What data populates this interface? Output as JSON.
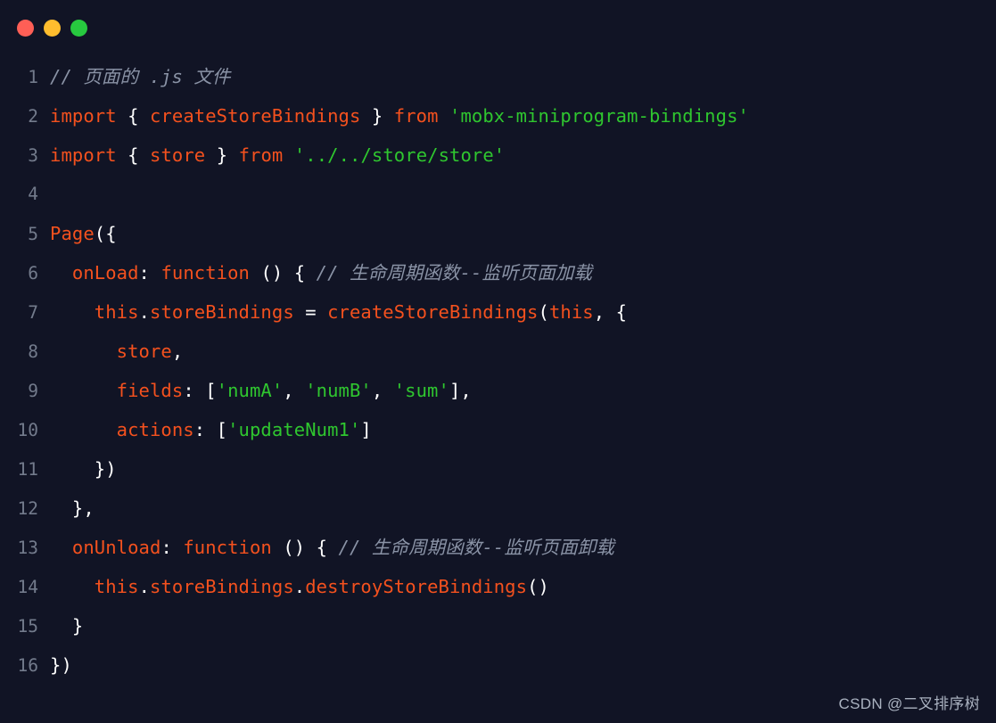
{
  "window": {
    "dots": [
      {
        "name": "close-button",
        "color": "#ff5f56"
      },
      {
        "name": "minimize-button",
        "color": "#ffbd2e"
      },
      {
        "name": "maximize-button",
        "color": "#27c93f"
      }
    ]
  },
  "editor": {
    "language": "javascript",
    "background": "#111425",
    "colors": {
      "comment": "#8a93a6",
      "keyword": "#f4511e",
      "identifier": "#f4511e",
      "string": "#2fc62f",
      "punctuation": "#ffffff",
      "line_number": "#737b8c"
    },
    "lines": [
      {
        "number": "1",
        "tokens": [
          {
            "t": "// 页面的 .js 文件",
            "c": "comment"
          }
        ]
      },
      {
        "number": "2",
        "tokens": [
          {
            "t": "import",
            "c": "keyword"
          },
          {
            "t": " ",
            "c": "plain"
          },
          {
            "t": "{",
            "c": "punct"
          },
          {
            "t": " ",
            "c": "plain"
          },
          {
            "t": "createStoreBindings",
            "c": "ident"
          },
          {
            "t": " ",
            "c": "plain"
          },
          {
            "t": "}",
            "c": "punct"
          },
          {
            "t": " ",
            "c": "plain"
          },
          {
            "t": "from",
            "c": "keyword"
          },
          {
            "t": " ",
            "c": "plain"
          },
          {
            "t": "'mobx-miniprogram-bindings'",
            "c": "string"
          }
        ]
      },
      {
        "number": "3",
        "tokens": [
          {
            "t": "import",
            "c": "keyword"
          },
          {
            "t": " ",
            "c": "plain"
          },
          {
            "t": "{",
            "c": "punct"
          },
          {
            "t": " ",
            "c": "plain"
          },
          {
            "t": "store",
            "c": "ident"
          },
          {
            "t": " ",
            "c": "plain"
          },
          {
            "t": "}",
            "c": "punct"
          },
          {
            "t": " ",
            "c": "plain"
          },
          {
            "t": "from",
            "c": "keyword"
          },
          {
            "t": " ",
            "c": "plain"
          },
          {
            "t": "'../../store/store'",
            "c": "string"
          }
        ]
      },
      {
        "number": "4",
        "tokens": []
      },
      {
        "number": "5",
        "tokens": [
          {
            "t": "Page",
            "c": "func"
          },
          {
            "t": "({",
            "c": "punct"
          }
        ]
      },
      {
        "number": "6",
        "tokens": [
          {
            "t": "  ",
            "c": "plain"
          },
          {
            "t": "onLoad",
            "c": "prop"
          },
          {
            "t": ": ",
            "c": "punct"
          },
          {
            "t": "function",
            "c": "keyword"
          },
          {
            "t": " ",
            "c": "plain"
          },
          {
            "t": "() { ",
            "c": "punct"
          },
          {
            "t": "// 生命周期函数--监听页面加载",
            "c": "comment"
          }
        ]
      },
      {
        "number": "7",
        "tokens": [
          {
            "t": "    ",
            "c": "plain"
          },
          {
            "t": "this",
            "c": "keyword"
          },
          {
            "t": ".",
            "c": "punct"
          },
          {
            "t": "storeBindings",
            "c": "prop"
          },
          {
            "t": " = ",
            "c": "punct"
          },
          {
            "t": "createStoreBindings",
            "c": "func"
          },
          {
            "t": "(",
            "c": "punct"
          },
          {
            "t": "this",
            "c": "keyword"
          },
          {
            "t": ", {",
            "c": "punct"
          }
        ]
      },
      {
        "number": "8",
        "tokens": [
          {
            "t": "      ",
            "c": "plain"
          },
          {
            "t": "store",
            "c": "ident"
          },
          {
            "t": ",",
            "c": "punct"
          }
        ]
      },
      {
        "number": "9",
        "tokens": [
          {
            "t": "      ",
            "c": "plain"
          },
          {
            "t": "fields",
            "c": "prop"
          },
          {
            "t": ": [",
            "c": "punct"
          },
          {
            "t": "'numA'",
            "c": "string"
          },
          {
            "t": ", ",
            "c": "punct"
          },
          {
            "t": "'numB'",
            "c": "string"
          },
          {
            "t": ", ",
            "c": "punct"
          },
          {
            "t": "'sum'",
            "c": "string"
          },
          {
            "t": "],",
            "c": "punct"
          }
        ]
      },
      {
        "number": "10",
        "tokens": [
          {
            "t": "      ",
            "c": "plain"
          },
          {
            "t": "actions",
            "c": "prop"
          },
          {
            "t": ": [",
            "c": "punct"
          },
          {
            "t": "'updateNum1'",
            "c": "string"
          },
          {
            "t": "]",
            "c": "punct"
          }
        ]
      },
      {
        "number": "11",
        "tokens": [
          {
            "t": "    })",
            "c": "punct"
          }
        ]
      },
      {
        "number": "12",
        "tokens": [
          {
            "t": "  },",
            "c": "punct"
          }
        ]
      },
      {
        "number": "13",
        "tokens": [
          {
            "t": "  ",
            "c": "plain"
          },
          {
            "t": "onUnload",
            "c": "prop"
          },
          {
            "t": ": ",
            "c": "punct"
          },
          {
            "t": "function",
            "c": "keyword"
          },
          {
            "t": " ",
            "c": "plain"
          },
          {
            "t": "() { ",
            "c": "punct"
          },
          {
            "t": "// 生命周期函数--监听页面卸载",
            "c": "comment"
          }
        ]
      },
      {
        "number": "14",
        "tokens": [
          {
            "t": "    ",
            "c": "plain"
          },
          {
            "t": "this",
            "c": "keyword"
          },
          {
            "t": ".",
            "c": "punct"
          },
          {
            "t": "storeBindings",
            "c": "prop"
          },
          {
            "t": ".",
            "c": "punct"
          },
          {
            "t": "destroyStoreBindings",
            "c": "func"
          },
          {
            "t": "()",
            "c": "punct"
          }
        ]
      },
      {
        "number": "15",
        "tokens": [
          {
            "t": "  }",
            "c": "punct"
          }
        ]
      },
      {
        "number": "16",
        "tokens": [
          {
            "t": "})",
            "c": "punct"
          }
        ]
      }
    ]
  },
  "watermark": {
    "text": "CSDN @二叉排序树"
  }
}
